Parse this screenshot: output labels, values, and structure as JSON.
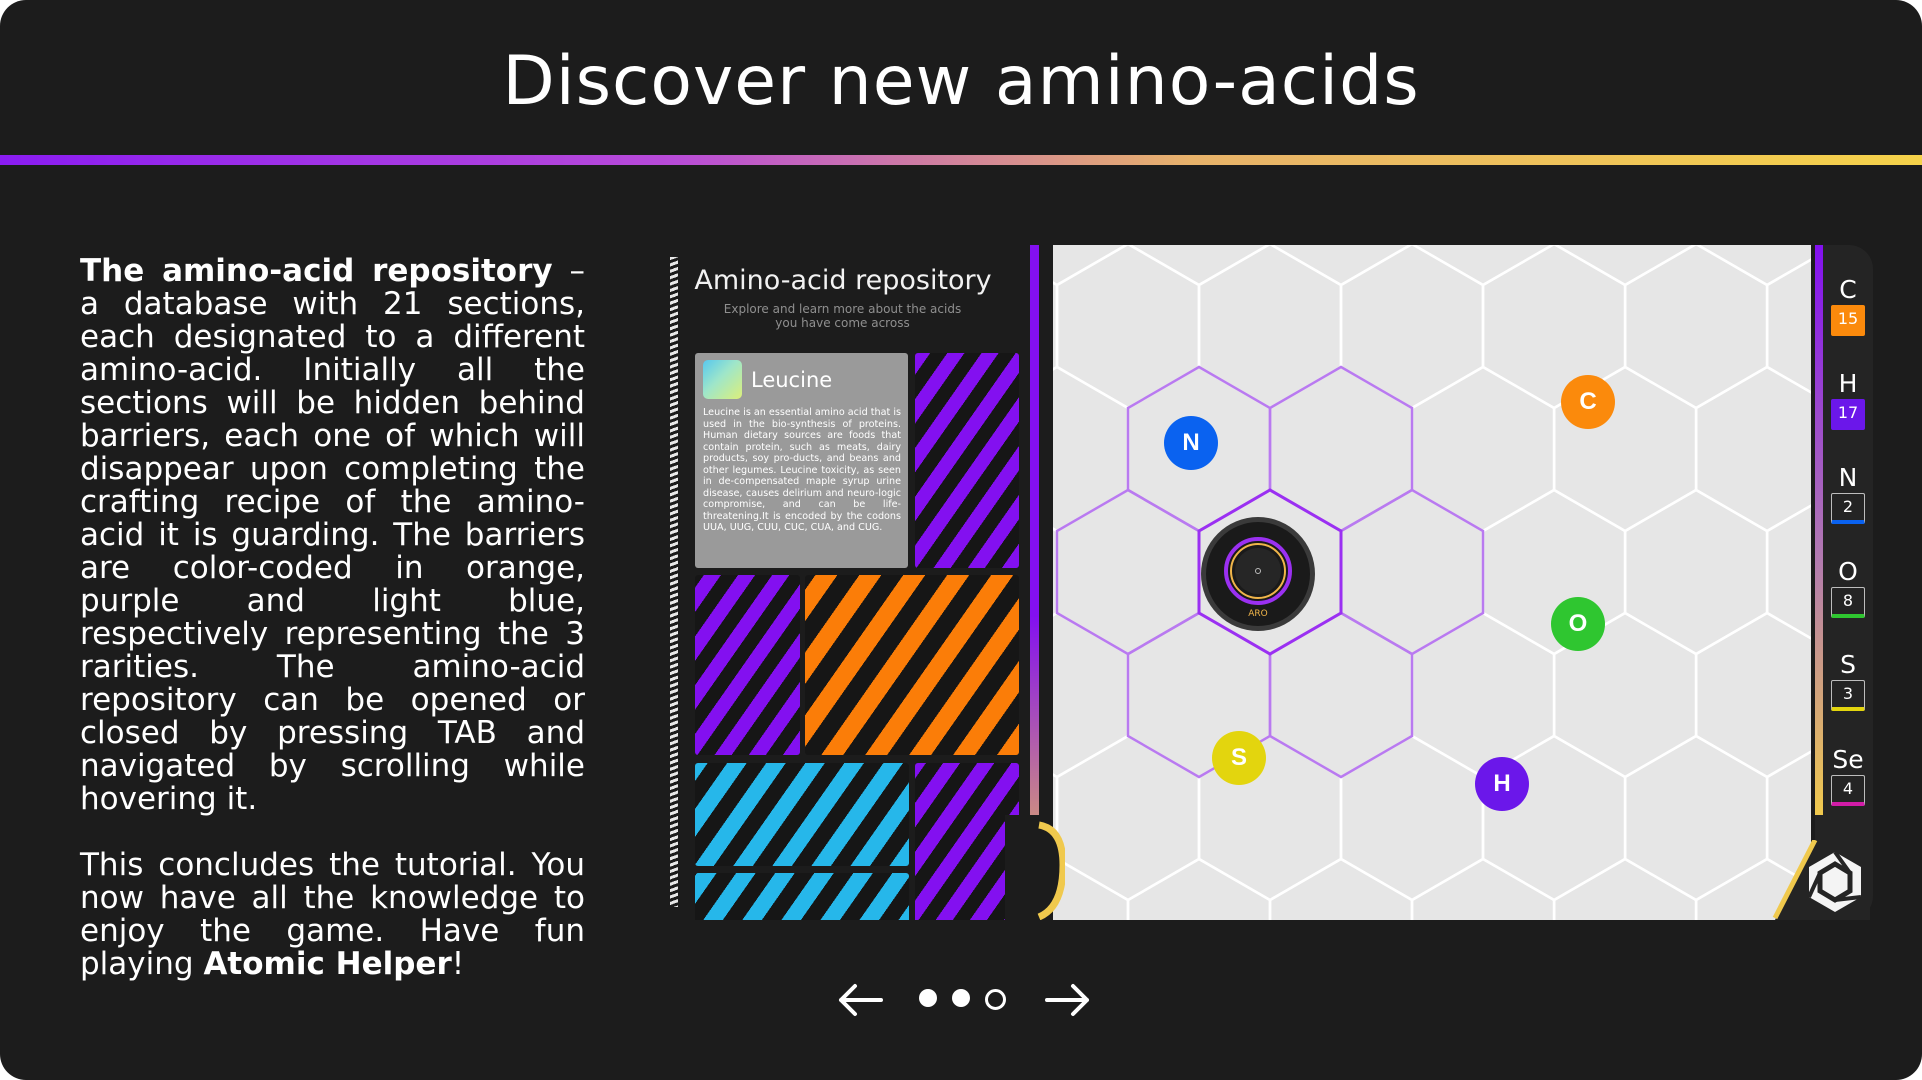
{
  "title": "Discover new amino-acids",
  "description": {
    "repo_heading": "The amino-acid repository",
    "repo_text": " – a database with 21 sections, each designated to a different amino-acid.  Initially all the sections will be hidden behind barriers, each one of which will disappear upon completing the crafting recipe of the amino-acid it is guarding. The barriers are color-coded in orange, purple and light blue, respectively representing the 3 rarities. The amino-acid repository can be opened or closed by pressing TAB and navigated by scrolling while hovering it.",
    "conclusion_text": "This concludes the tutorial. You now have all the knowledge to enjoy the game. Have fun playing ",
    "game_name": "Atomic Helper",
    "conclusion_end": "!"
  },
  "repository": {
    "title": "Amino-acid repository",
    "subtitle": "Explore and learn more about the acids you have come across",
    "card": {
      "name": "Leucine",
      "text": "Leucine is an essential amino acid that is used in the bio-synthesis of proteins. Human dietary sources are foods that contain protein, such as meats, dairy products, soy pro-ducts, and beans and other legumes. Leucine toxicity, as seen in de-compensated maple syrup urine disease, causes delirium and neuro-logic compromise, and can be life-threatening.It is encoded by the codons UUA, UUG, CUU, CUC, CUA, and CUG."
    },
    "barrier_colors": {
      "orange": "#fb7d08",
      "purple": "#8310f0",
      "light_blue": "#26b7ea"
    }
  },
  "board": {
    "core_label": "ARO",
    "atoms": [
      {
        "symbol": "N",
        "color": "#0a62f0"
      },
      {
        "symbol": "C",
        "color": "#fb8a0c"
      },
      {
        "symbol": "O",
        "color": "#2fc630"
      },
      {
        "symbol": "S",
        "color": "#e3d50e"
      },
      {
        "symbol": "H",
        "color": "#6b17ea"
      }
    ]
  },
  "inventory": [
    {
      "symbol": "C",
      "count": "15",
      "color": "#fb8a0c",
      "filled": true
    },
    {
      "symbol": "H",
      "count": "17",
      "color": "#6b17ea",
      "filled": true
    },
    {
      "symbol": "N",
      "count": "2",
      "color": "#0a62f0",
      "filled": false
    },
    {
      "symbol": "O",
      "count": "8",
      "color": "#2fc630",
      "filled": false
    },
    {
      "symbol": "S",
      "count": "3",
      "color": "#e3d50e",
      "filled": false
    },
    {
      "symbol": "Se",
      "count": "4",
      "color": "#d21ca8",
      "filled": false
    }
  ],
  "pager": {
    "pages": 3,
    "current_page": 3,
    "prev_icon": "arrow-left-icon",
    "next_icon": "arrow-right-icon"
  }
}
